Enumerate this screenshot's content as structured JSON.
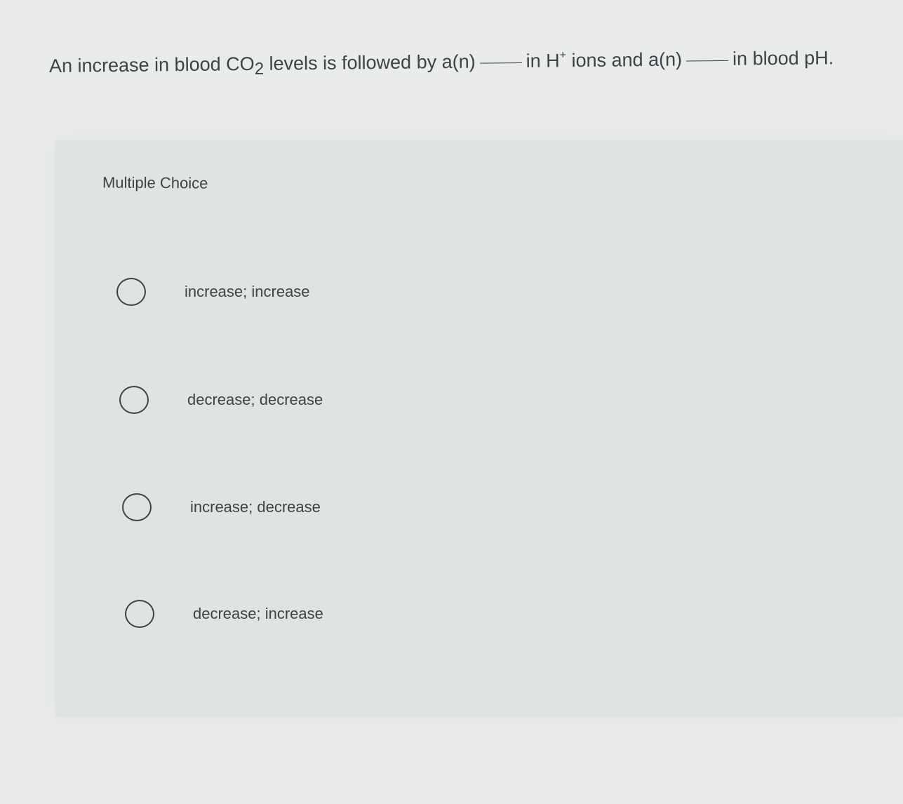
{
  "question": {
    "part1": "An increase in blood CO",
    "co2_subscript": "2",
    "part2": " levels is followed by a(n)",
    "part3": "in H",
    "h_superscript": "+",
    "part4": " ions and a(n)",
    "part5": "in blood pH."
  },
  "multiple_choice": {
    "label": "Multiple Choice",
    "options": [
      {
        "label": "increase; increase"
      },
      {
        "label": "decrease; decrease"
      },
      {
        "label": "increase; decrease"
      },
      {
        "label": "decrease; increase"
      }
    ]
  }
}
